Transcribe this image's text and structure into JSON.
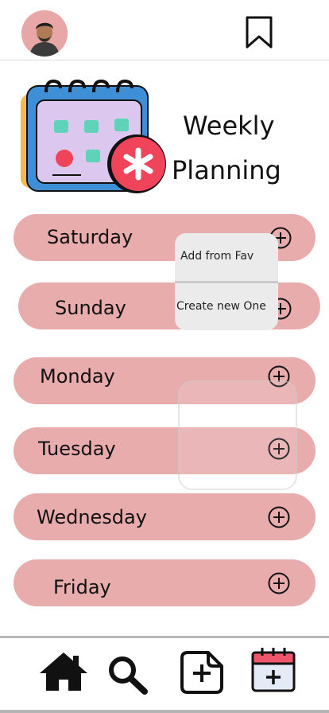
{
  "header": {
    "avatar_icon": "user-avatar",
    "bookmark_icon": "bookmark-icon"
  },
  "hero": {
    "title_line1": "Weekly",
    "title_line2": "Planning",
    "illustration_icon": "calendar-illustration"
  },
  "days": [
    {
      "label": "Saturday"
    },
    {
      "label": "Sunday"
    },
    {
      "label": "Monday"
    },
    {
      "label": "Tuesday"
    },
    {
      "label": "Wednesday"
    },
    {
      "label": "Friday"
    }
  ],
  "popup": {
    "option1": "Add from Fav",
    "option2": "Create new One"
  },
  "bottom_nav": {
    "items": [
      {
        "icon": "home-icon"
      },
      {
        "icon": "search-icon"
      },
      {
        "icon": "add-post-icon"
      },
      {
        "icon": "calendar-add-icon"
      }
    ]
  },
  "colors": {
    "pill": "#e8acad",
    "accent_red": "#f0445a",
    "calendar_blue": "#3f8fd6",
    "popup_bg": "#ebebeb"
  }
}
